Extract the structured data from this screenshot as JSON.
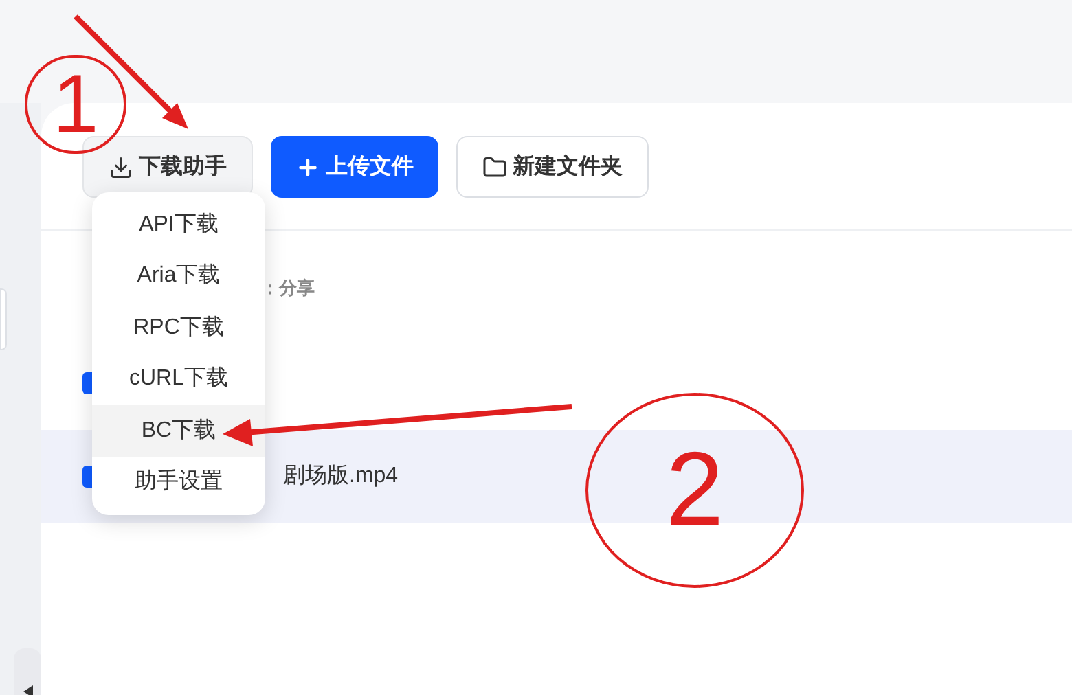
{
  "toolbar": [
    {
      "label": "下载助手",
      "kind": "download"
    },
    {
      "label": "上传文件",
      "kind": "upload"
    },
    {
      "label": "新建文件夹",
      "kind": "folder"
    }
  ],
  "dropdown": [
    {
      "label": "API下载",
      "selected": false
    },
    {
      "label": "Aria下载",
      "selected": false
    },
    {
      "label": "RPC下载",
      "selected": false
    },
    {
      "label": "cURL下载",
      "selected": false
    },
    {
      "label": "BC下载",
      "selected": true
    },
    {
      "label": "助手设置",
      "selected": false
    }
  ],
  "breadcrumb": "：分享",
  "rows": [
    {
      "checked": true,
      "selected": false
    },
    {
      "name": "剧场版.mp4",
      "checked": true,
      "selected": true
    }
  ],
  "annotations": [
    {
      "label": "1"
    },
    {
      "label": "2"
    }
  ]
}
